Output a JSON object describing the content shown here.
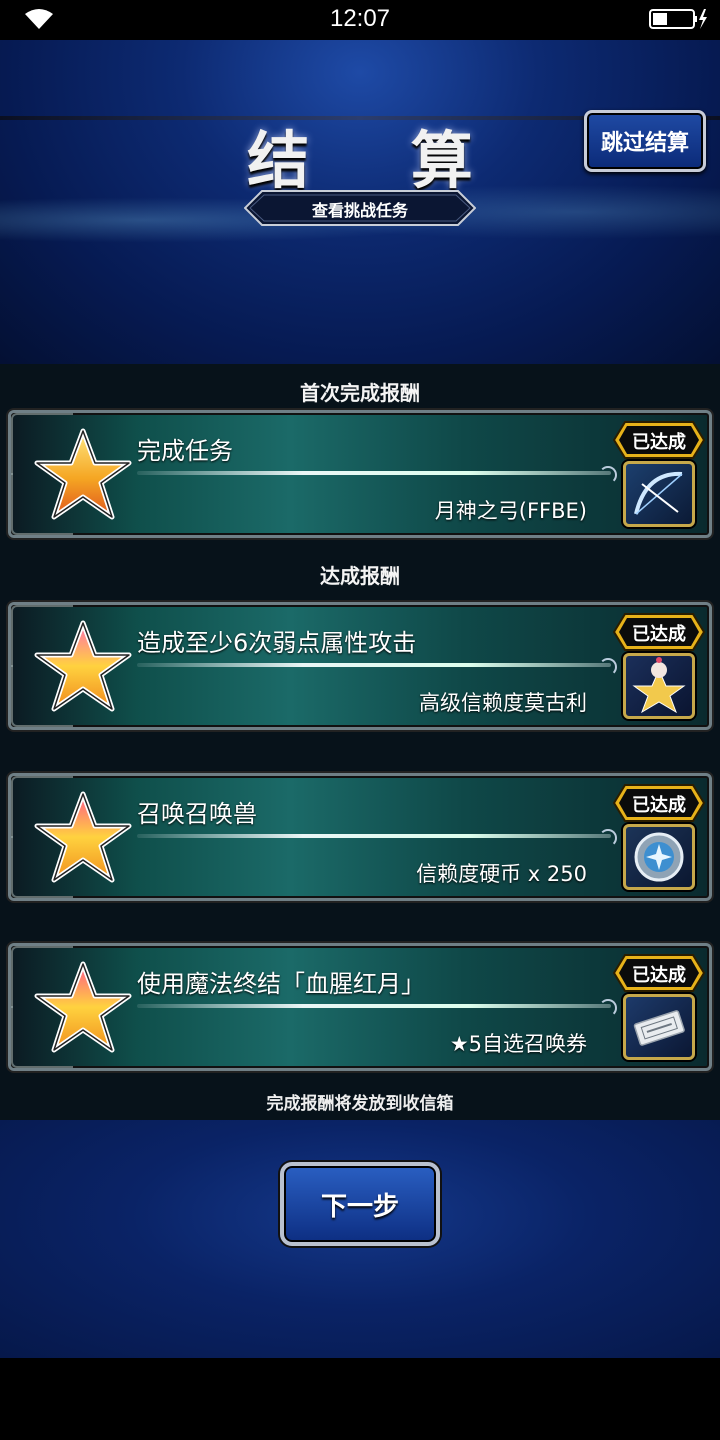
{
  "status_bar": {
    "time": "12:07"
  },
  "header": {
    "title": "结 算",
    "skip_button": "跳过结算",
    "mission_button": "查看挑战任务"
  },
  "sections": {
    "first_clear": "首次完成报酬",
    "achievement": "达成报酬"
  },
  "cards": [
    {
      "title": "完成任务",
      "reward": "月神之弓(FFBE)",
      "status": "已达成",
      "icon": "bow-icon"
    },
    {
      "title": "造成至少6次弱点属性攻击",
      "reward": "高级信赖度莫古利",
      "status": "已达成",
      "icon": "moogle-icon"
    },
    {
      "title": "召唤召唤兽",
      "reward": "信赖度硬币 x 250",
      "status": "已达成",
      "icon": "coin-icon"
    },
    {
      "title": "使用魔法终结「血腥红月」",
      "reward": "★5自选召唤券",
      "status": "已达成",
      "icon": "ticket-icon"
    }
  ],
  "footer_note": "完成报酬将发放到收信箱",
  "next_button": "下一步",
  "colors": {
    "header_blue": "#0d2a72",
    "teal": "#1b6a68",
    "gold": "#e7b21a",
    "dark": "#07121a"
  }
}
